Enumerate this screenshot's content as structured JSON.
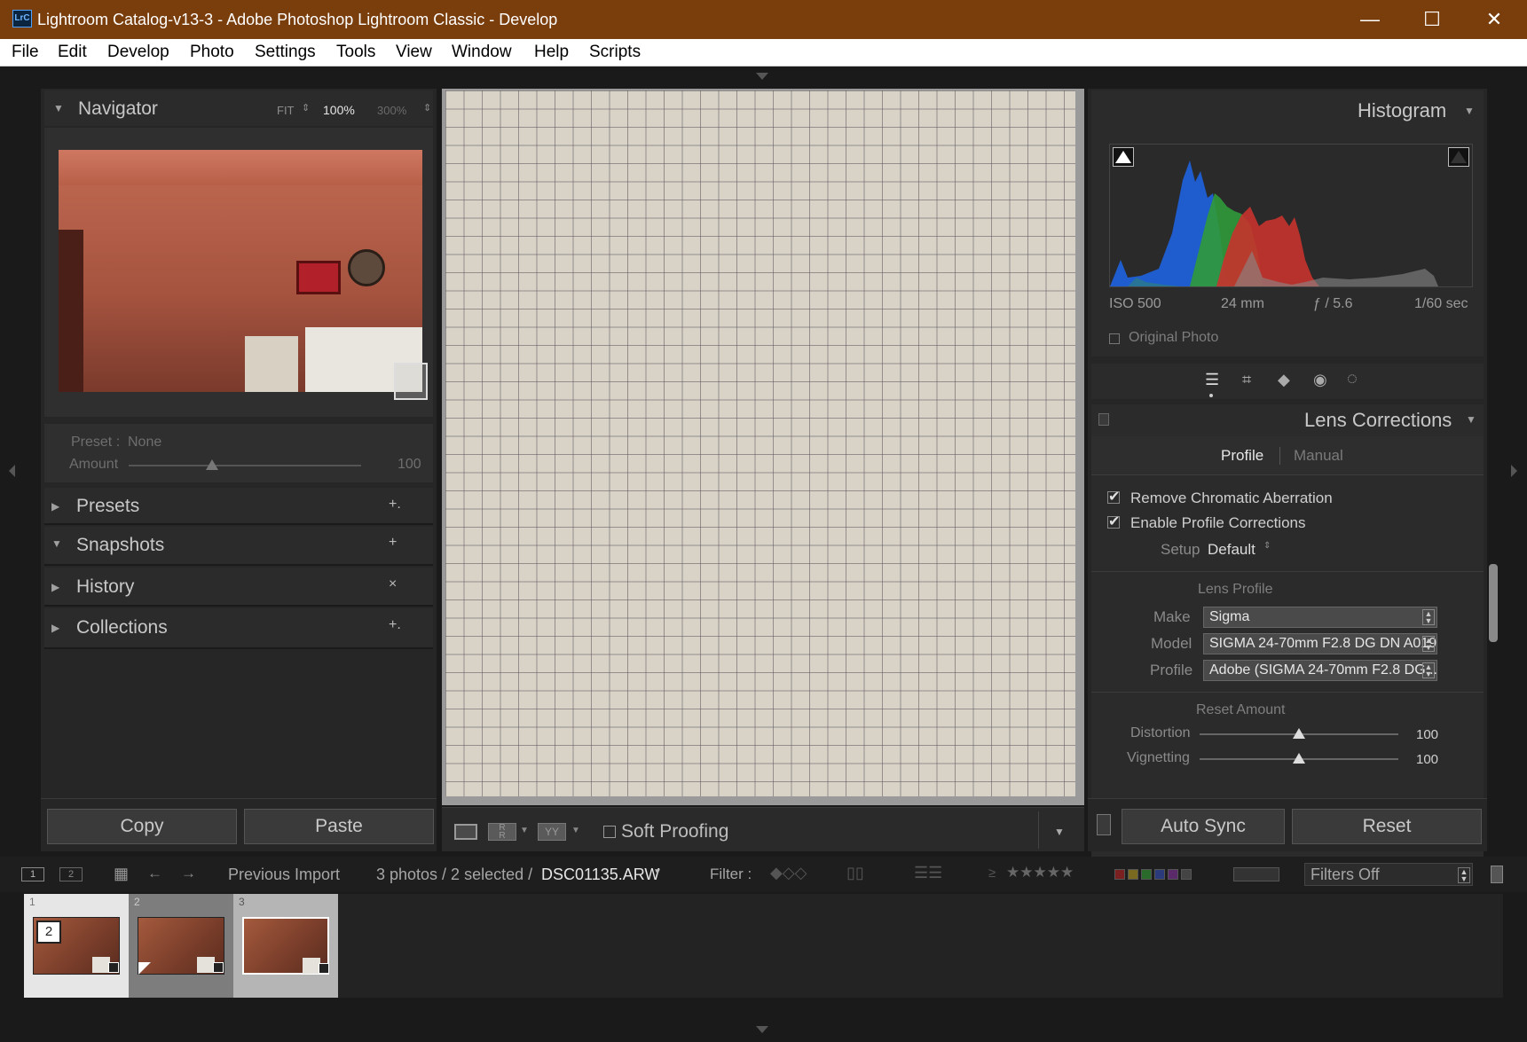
{
  "window": {
    "logo": "LrC",
    "title": "Lightroom Catalog-v13-3 - Adobe Photoshop Lightroom Classic - Develop",
    "minimize": "—",
    "maximize": "☐",
    "close": "✕"
  },
  "menu": [
    "File",
    "Edit",
    "Develop",
    "Photo",
    "Settings",
    "Tools",
    "View",
    "Window",
    "Help",
    "Scripts"
  ],
  "navigator": {
    "title": "Navigator",
    "zoom_fit": "FIT",
    "zoom_100": "100%",
    "zoom_300": "300%"
  },
  "preset_box": {
    "preset_label": "Preset :",
    "preset_value": "None",
    "amount_label": "Amount",
    "amount_value": "100",
    "amount_fraction": 0.36
  },
  "left_panels": [
    {
      "label": "Presets",
      "action": "+."
    },
    {
      "label": "Snapshots",
      "action": "+"
    },
    {
      "label": "History",
      "action": "×"
    },
    {
      "label": "Collections",
      "action": "+."
    }
  ],
  "left_buttons": {
    "copy": "Copy",
    "paste": "Paste"
  },
  "toolbar": {
    "soft_proofing": "Soft Proofing"
  },
  "histogram": {
    "title": "Histogram",
    "iso": "ISO 500",
    "focal": "24 mm",
    "aperture": "ƒ / 5.6",
    "shutter": "1/60 sec",
    "original_photo": "Original Photo"
  },
  "lens": {
    "title": "Lens Corrections",
    "tab_profile": "Profile",
    "tab_manual": "Manual",
    "remove_ca": "Remove Chromatic Aberration",
    "enable_profile": "Enable Profile Corrections",
    "setup_label": "Setup",
    "setup_value": "Default",
    "lens_profile_heading": "Lens Profile",
    "make_label": "Make",
    "make_value": "Sigma",
    "model_label": "Model",
    "model_value": "SIGMA 24-70mm F2.8 DG DN A019",
    "profile_label": "Profile",
    "profile_value": "Adobe (SIGMA 24-70mm F2.8 DG...",
    "amount_heading": "Reset Amount",
    "distortion_label": "Distortion",
    "distortion_value": "100",
    "distortion_fraction": 0.5,
    "vignetting_label": "Vignetting",
    "vignetting_value": "100",
    "vignetting_fraction": 0.5
  },
  "right_buttons": {
    "auto_sync": "Auto Sync",
    "reset": "Reset"
  },
  "filmstrip_bar": {
    "screen1": "1",
    "screen2": "2",
    "source": "Previous Import",
    "count": "3 photos / 2 selected /",
    "filename": "DSC01135.ARW",
    "filter_label": "Filter :",
    "rating_op": "≥",
    "stars": "★★★★★",
    "filters_off": "Filters Off"
  },
  "thumbnails": [
    {
      "index": "1",
      "badge": "2"
    },
    {
      "index": "2",
      "badge": ""
    },
    {
      "index": "3",
      "badge": ""
    }
  ],
  "colors": {
    "titlebar": "#7a3d0c",
    "panel": "#2b2b2b",
    "histogram_blue": "#1f5fd6",
    "histogram_green": "#2f9a3a",
    "histogram_red": "#c8332e"
  }
}
